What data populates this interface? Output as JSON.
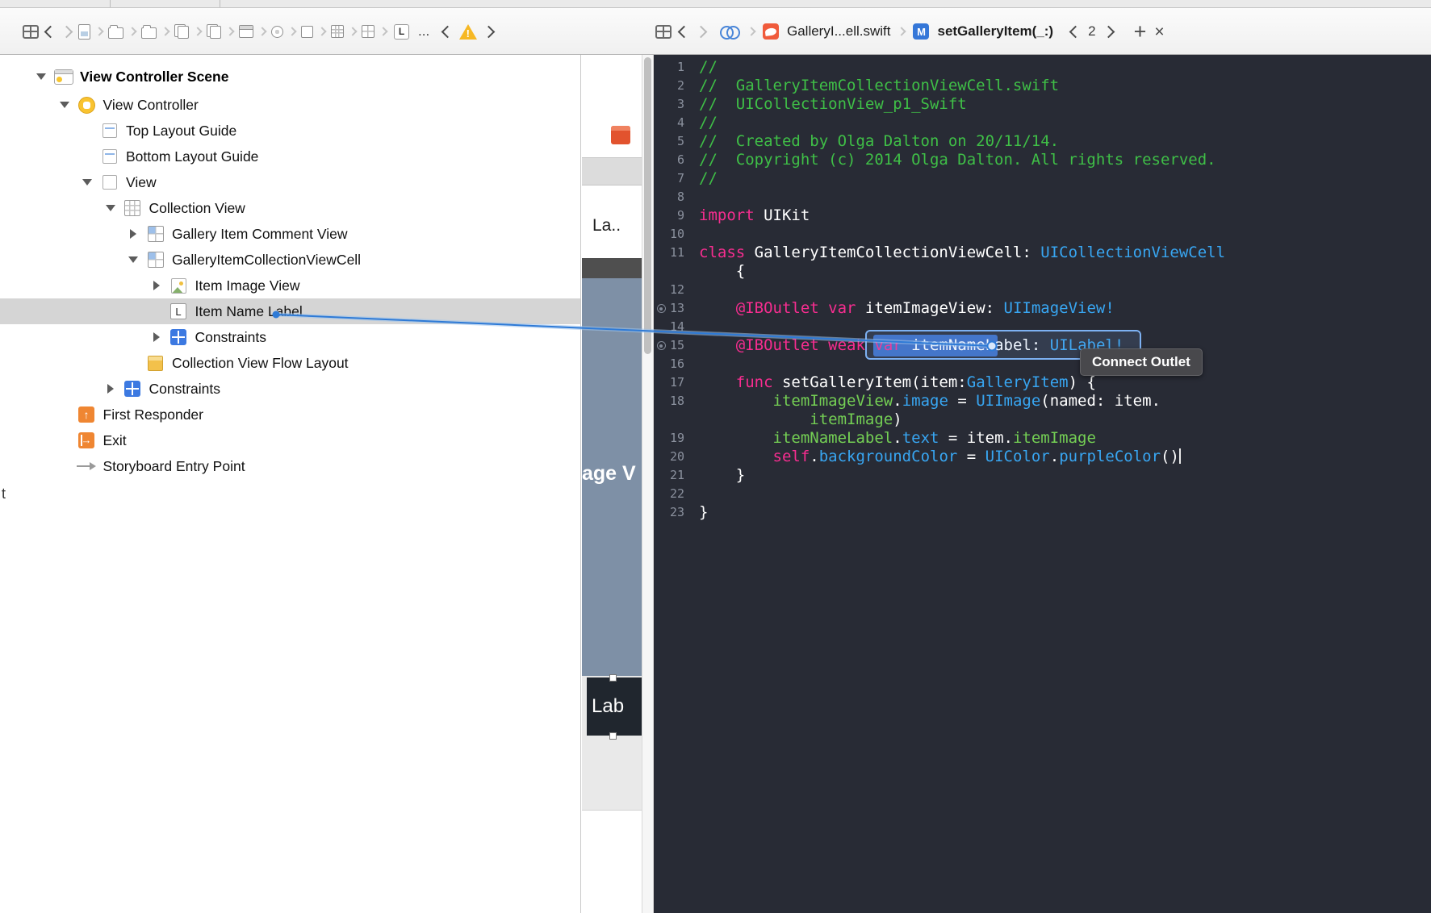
{
  "window": {
    "stray_text": "t"
  },
  "colors": {
    "editor_bg": "#282b35",
    "accent_blue": "#2e7ad6",
    "selection_gray": "#d5d5d5",
    "comment_green": "#3fbf47",
    "keyword_pink": "#f72d90",
    "type_blue": "#38a6f2",
    "project_green": "#74cf54",
    "warning_yellow": "#f6b824"
  },
  "toolbar": {
    "left": {
      "jump_icons": [
        "file-preview-icon",
        "folder-icon",
        "folder-icon",
        "file-pair-icon",
        "file-pair-icon",
        "storyboard-icon",
        "vc-crumb-icon",
        "view-crumb-icon",
        "collection-crumb-icon",
        "cell-crumb-icon"
      ],
      "label_item": "L",
      "ellipsis": "..."
    },
    "right": {
      "file_label": "GalleryI...ell.swift",
      "badge": "M",
      "symbol_label": "setGalleryItem(_:)",
      "counter": "2",
      "add_label": "+",
      "close_label": "×"
    }
  },
  "outline": {
    "items": [
      {
        "label": "View Controller Scene",
        "level": 0,
        "disclosure": "open",
        "icon": "scene-icon",
        "bold": true
      },
      {
        "label": "View Controller",
        "level": 1,
        "disclosure": "open",
        "icon": "view-controller-icon"
      },
      {
        "label": "Top Layout Guide",
        "level": 2,
        "disclosure": "none",
        "icon": "layout-guide-icon"
      },
      {
        "label": "Bottom Layout Guide",
        "level": 2,
        "disclosure": "none",
        "icon": "layout-guide-icon"
      },
      {
        "label": "View",
        "level": 2,
        "disclosure": "open",
        "icon": "view-icon"
      },
      {
        "label": "Collection View",
        "level": 3,
        "disclosure": "open",
        "icon": "collection-view-icon"
      },
      {
        "label": "Gallery Item Comment View",
        "level": 4,
        "disclosure": "closed",
        "icon": "collection-cell-icon"
      },
      {
        "label": "GalleryItemCollectionViewCell",
        "level": 4,
        "disclosure": "open",
        "icon": "collection-cell-icon"
      },
      {
        "label": "Item Image View",
        "level": 5,
        "disclosure": "closed",
        "icon": "image-view-icon"
      },
      {
        "label": "Item Name Label",
        "level": 5,
        "disclosure": "none",
        "icon": "label-icon",
        "glyph": "L",
        "selected": true
      },
      {
        "label": "Constraints",
        "level": 5,
        "disclosure": "closed",
        "icon": "constraints-icon"
      },
      {
        "label": "Collection View Flow Layout",
        "level": 4,
        "disclosure": "none",
        "icon": "flow-layout-icon"
      },
      {
        "label": "Constraints",
        "level": 3,
        "disclosure": "closed",
        "icon": "constraints-icon"
      },
      {
        "label": "First Responder",
        "level": 1,
        "disclosure": "none",
        "icon": "first-responder-icon"
      },
      {
        "label": "Exit",
        "level": 1,
        "disclosure": "none",
        "icon": "exit-icon"
      },
      {
        "label": "Storyboard Entry Point",
        "level": 1,
        "disclosure": "none",
        "icon": "entry-point-icon"
      }
    ]
  },
  "canvas": {
    "partial_label_top": "La..",
    "partial_image_text": "age V",
    "partial_label_bottom": "Lab"
  },
  "editor": {
    "tooltip": "Connect Outlet",
    "lines": [
      {
        "n": "1",
        "seg": [
          [
            "c",
            "//"
          ]
        ]
      },
      {
        "n": "2",
        "seg": [
          [
            "c",
            "//  GalleryItemCollectionViewCell.swift"
          ]
        ]
      },
      {
        "n": "3",
        "seg": [
          [
            "c",
            "//  UICollectionView_p1_Swift"
          ]
        ]
      },
      {
        "n": "4",
        "seg": [
          [
            "c",
            "//"
          ]
        ]
      },
      {
        "n": "5",
        "seg": [
          [
            "c",
            "//  Created by Olga Dalton on 20/11/14."
          ]
        ]
      },
      {
        "n": "6",
        "seg": [
          [
            "c",
            "//  Copyright (c) 2014 Olga Dalton. All rights reserved."
          ]
        ]
      },
      {
        "n": "7",
        "seg": [
          [
            "c",
            "//"
          ]
        ]
      },
      {
        "n": "8",
        "seg": []
      },
      {
        "n": "9",
        "seg": [
          [
            "k",
            "import"
          ],
          [
            "w",
            " UIKit"
          ]
        ]
      },
      {
        "n": "10",
        "seg": []
      },
      {
        "n": "11",
        "seg": [
          [
            "k",
            "class"
          ],
          [
            "w",
            " GalleryItemCollectionViewCell: "
          ],
          [
            "t",
            "UICollectionViewCell"
          ]
        ]
      },
      {
        "n": "",
        "seg": [
          [
            "w",
            "    {"
          ]
        ]
      },
      {
        "n": "12",
        "seg": []
      },
      {
        "n": "13",
        "well": true,
        "seg": [
          [
            "w",
            "    "
          ],
          [
            "k",
            "@IBOutlet"
          ],
          [
            "w",
            " "
          ],
          [
            "k",
            "var"
          ],
          [
            "w",
            " itemImageView: "
          ],
          [
            "t",
            "UIImageView!"
          ]
        ]
      },
      {
        "n": "14",
        "seg": []
      },
      {
        "n": "15",
        "well": true,
        "seg": [
          [
            "w",
            "    "
          ],
          [
            "k",
            "@IBOutlet"
          ],
          [
            "w",
            " "
          ],
          [
            "k",
            "weak"
          ],
          [
            "w",
            " "
          ],
          [
            "k",
            "var"
          ],
          [
            "w",
            " itemNameLabel: "
          ],
          [
            "t",
            "UILabel!"
          ]
        ]
      },
      {
        "n": "16",
        "seg": []
      },
      {
        "n": "17",
        "seg": [
          [
            "w",
            "    "
          ],
          [
            "k",
            "func"
          ],
          [
            "w",
            " setGalleryItem(item:"
          ],
          [
            "t",
            "GalleryItem"
          ],
          [
            "w",
            ") {"
          ]
        ]
      },
      {
        "n": "18",
        "seg": [
          [
            "w",
            "        "
          ],
          [
            "p",
            "itemImageView"
          ],
          [
            "w",
            "."
          ],
          [
            "t",
            "image"
          ],
          [
            "w",
            " = "
          ],
          [
            "t",
            "UIImage"
          ],
          [
            "w",
            "(named: item."
          ]
        ]
      },
      {
        "n": "",
        "seg": [
          [
            "w",
            "            "
          ],
          [
            "p",
            "itemImage"
          ],
          [
            "w",
            ")"
          ]
        ]
      },
      {
        "n": "19",
        "seg": [
          [
            "w",
            "        "
          ],
          [
            "p",
            "itemNameLabel"
          ],
          [
            "w",
            "."
          ],
          [
            "t",
            "text"
          ],
          [
            "w",
            " = item."
          ],
          [
            "p",
            "itemImage"
          ]
        ]
      },
      {
        "n": "20",
        "caret": true,
        "seg": [
          [
            "w",
            "        "
          ],
          [
            "k",
            "self"
          ],
          [
            "w",
            "."
          ],
          [
            "t",
            "backgroundColor"
          ],
          [
            "w",
            " = "
          ],
          [
            "t",
            "UIColor"
          ],
          [
            "w",
            "."
          ],
          [
            "t",
            "purpleColor"
          ],
          [
            "w",
            "()"
          ]
        ]
      },
      {
        "n": "21",
        "seg": [
          [
            "w",
            "    }"
          ]
        ]
      },
      {
        "n": "22",
        "seg": []
      },
      {
        "n": "23",
        "seg": [
          [
            "w",
            "}"
          ]
        ]
      }
    ]
  }
}
